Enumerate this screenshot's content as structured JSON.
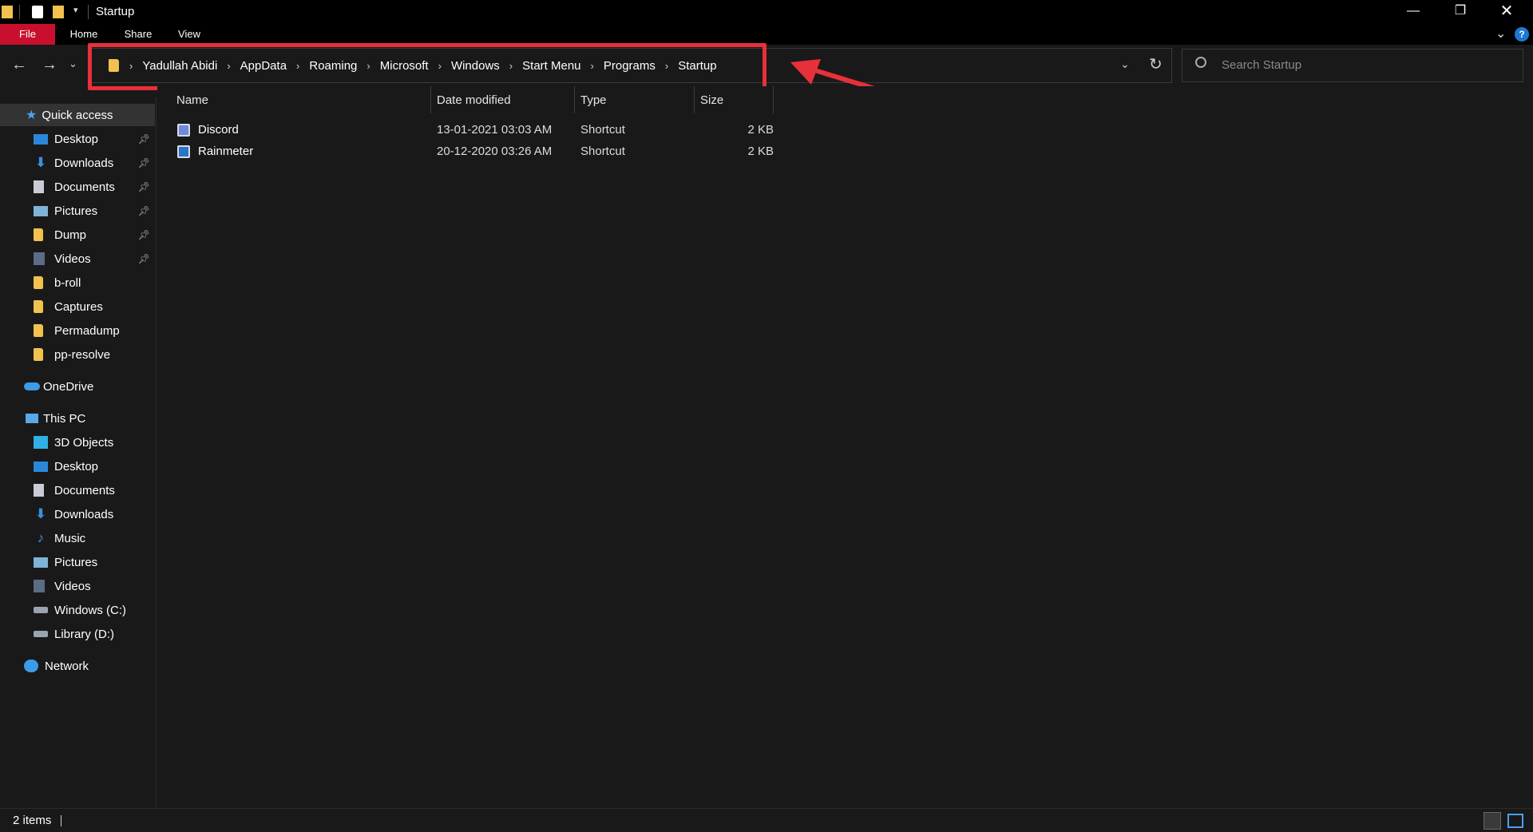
{
  "window": {
    "title": "Startup"
  },
  "ribbon": {
    "tabs": [
      "File",
      "Home",
      "Share",
      "View"
    ]
  },
  "address": {
    "crumbs": [
      "Yadullah Abidi",
      "AppData",
      "Roaming",
      "Microsoft",
      "Windows",
      "Start Menu",
      "Programs",
      "Startup"
    ]
  },
  "search": {
    "placeholder": "Search Startup"
  },
  "sidebar": {
    "quick_access": "Quick access",
    "quick_items": [
      {
        "label": "Desktop",
        "icon": "desktop-icon",
        "pinned": true
      },
      {
        "label": "Downloads",
        "icon": "download-icon",
        "pinned": true
      },
      {
        "label": "Documents",
        "icon": "documents-icon",
        "pinned": true
      },
      {
        "label": "Pictures",
        "icon": "pictures-icon",
        "pinned": true
      },
      {
        "label": "Dump",
        "icon": "folder-icon",
        "pinned": true
      },
      {
        "label": "Videos",
        "icon": "videos-icon",
        "pinned": true
      },
      {
        "label": "b-roll",
        "icon": "folder-icon",
        "pinned": false
      },
      {
        "label": "Captures",
        "icon": "folder-icon",
        "pinned": false
      },
      {
        "label": "Permadump",
        "icon": "folder-icon",
        "pinned": false
      },
      {
        "label": "pp-resolve",
        "icon": "folder-icon",
        "pinned": false
      }
    ],
    "onedrive": "OneDrive",
    "this_pc": "This PC",
    "pc_items": [
      {
        "label": "3D Objects",
        "icon": "3d-objects-icon"
      },
      {
        "label": "Desktop",
        "icon": "desktop-icon"
      },
      {
        "label": "Documents",
        "icon": "documents-icon"
      },
      {
        "label": "Downloads",
        "icon": "download-icon"
      },
      {
        "label": "Music",
        "icon": "music-icon"
      },
      {
        "label": "Pictures",
        "icon": "pictures-icon"
      },
      {
        "label": "Videos",
        "icon": "videos-icon"
      },
      {
        "label": "Windows (C:)",
        "icon": "drive-icon"
      },
      {
        "label": "Library (D:)",
        "icon": "drive-icon"
      }
    ],
    "network": "Network"
  },
  "columns": {
    "name": "Name",
    "date": "Date modified",
    "type": "Type",
    "size": "Size"
  },
  "files": [
    {
      "name": "Discord",
      "date": "13-01-2021 03:03 AM",
      "type": "Shortcut",
      "size": "2 KB"
    },
    {
      "name": "Rainmeter",
      "date": "20-12-2020 03:26 AM",
      "type": "Shortcut",
      "size": "2 KB"
    }
  ],
  "status": {
    "items": "2 items"
  },
  "colors": {
    "accent": "#c8102e",
    "highlight": "#e8303b",
    "background": "#191919"
  }
}
